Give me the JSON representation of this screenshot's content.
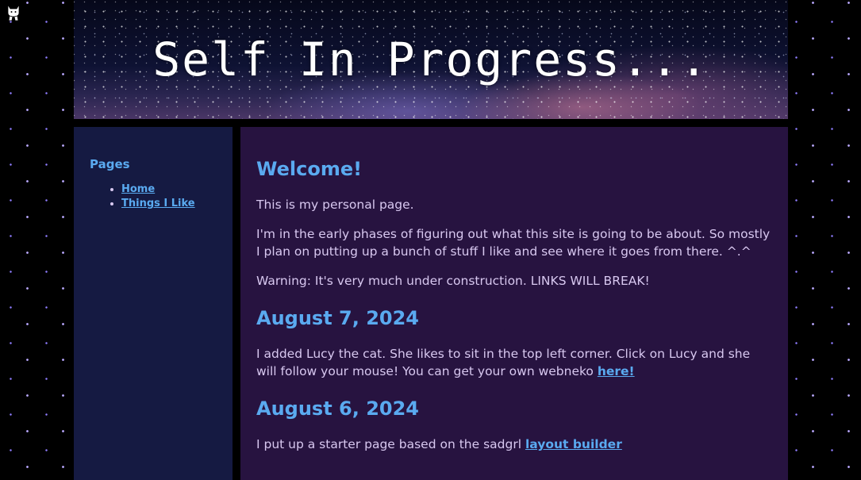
{
  "header": {
    "title": "Self In Progress..."
  },
  "sidebar": {
    "heading": "Pages",
    "items": [
      {
        "label": "Home"
      },
      {
        "label": "Things I Like"
      }
    ]
  },
  "main": {
    "welcome_heading": "Welcome!",
    "intro_1": "This is my personal page.",
    "intro_2": "I'm in the early phases of figuring out what this site is going to be about. So mostly I plan on putting up a bunch of stuff I like and see where it goes from there. ^.^",
    "intro_3": "Warning: It's very much under construction. LINKS WILL BREAK!",
    "posts": [
      {
        "date": "August 7, 2024",
        "text": "I added Lucy the cat. She likes to sit in the top left corner. Click on Lucy and she will follow your mouse! You can get your own webneko ",
        "link": "here!"
      },
      {
        "date": "August 6, 2024",
        "text": "I put up a starter page based on the sadgrl ",
        "link": "layout builder"
      }
    ]
  },
  "colors": {
    "accent": "#5aaaf0",
    "body_text": "#d8c8f0",
    "main_bg": "#271340",
    "sidebar_bg": "#151a42",
    "page_bg": "#000000"
  },
  "icons": {
    "neko": "cat-icon"
  }
}
